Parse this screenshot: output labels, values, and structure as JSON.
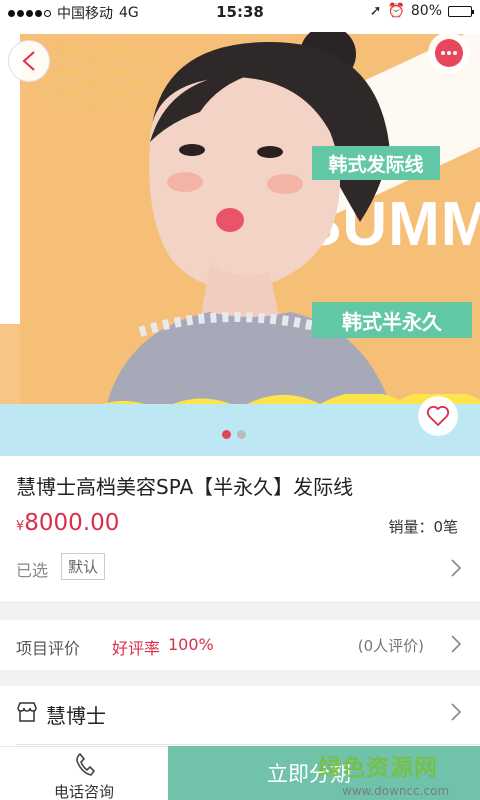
{
  "status_bar": {
    "carrier": "中国移动",
    "network": "4G",
    "time": "15:38",
    "battery": "80%",
    "battery_level": 0.8
  },
  "hero": {
    "tag_top": "韩式发际线",
    "banner_word": "SUMM",
    "tag_bottom": "韩式半永久",
    "carousel_count": 2,
    "carousel_active": 0
  },
  "product": {
    "title": "慧博士高档美容SPA【半永久】发际线",
    "currency": "¥",
    "price": "8000.00",
    "sales": "销量：0笔",
    "selected_label": "已选",
    "selected_value": "默认"
  },
  "review": {
    "label": "项目评价",
    "rate_label": "好评率",
    "rate": "100%",
    "count": "(0人评价)"
  },
  "store": {
    "name": "慧博士"
  },
  "bottom_bar": {
    "call_label": "电话咨询",
    "installment_label": "立即分期"
  },
  "watermark": {
    "main": "绿色资源网",
    "url": "www.downcc.com"
  },
  "colors": {
    "accent": "#d9304a",
    "green_button": "#71c2aa",
    "tag_green": "#62c7a4",
    "hero_orange": "#f6bf78"
  }
}
